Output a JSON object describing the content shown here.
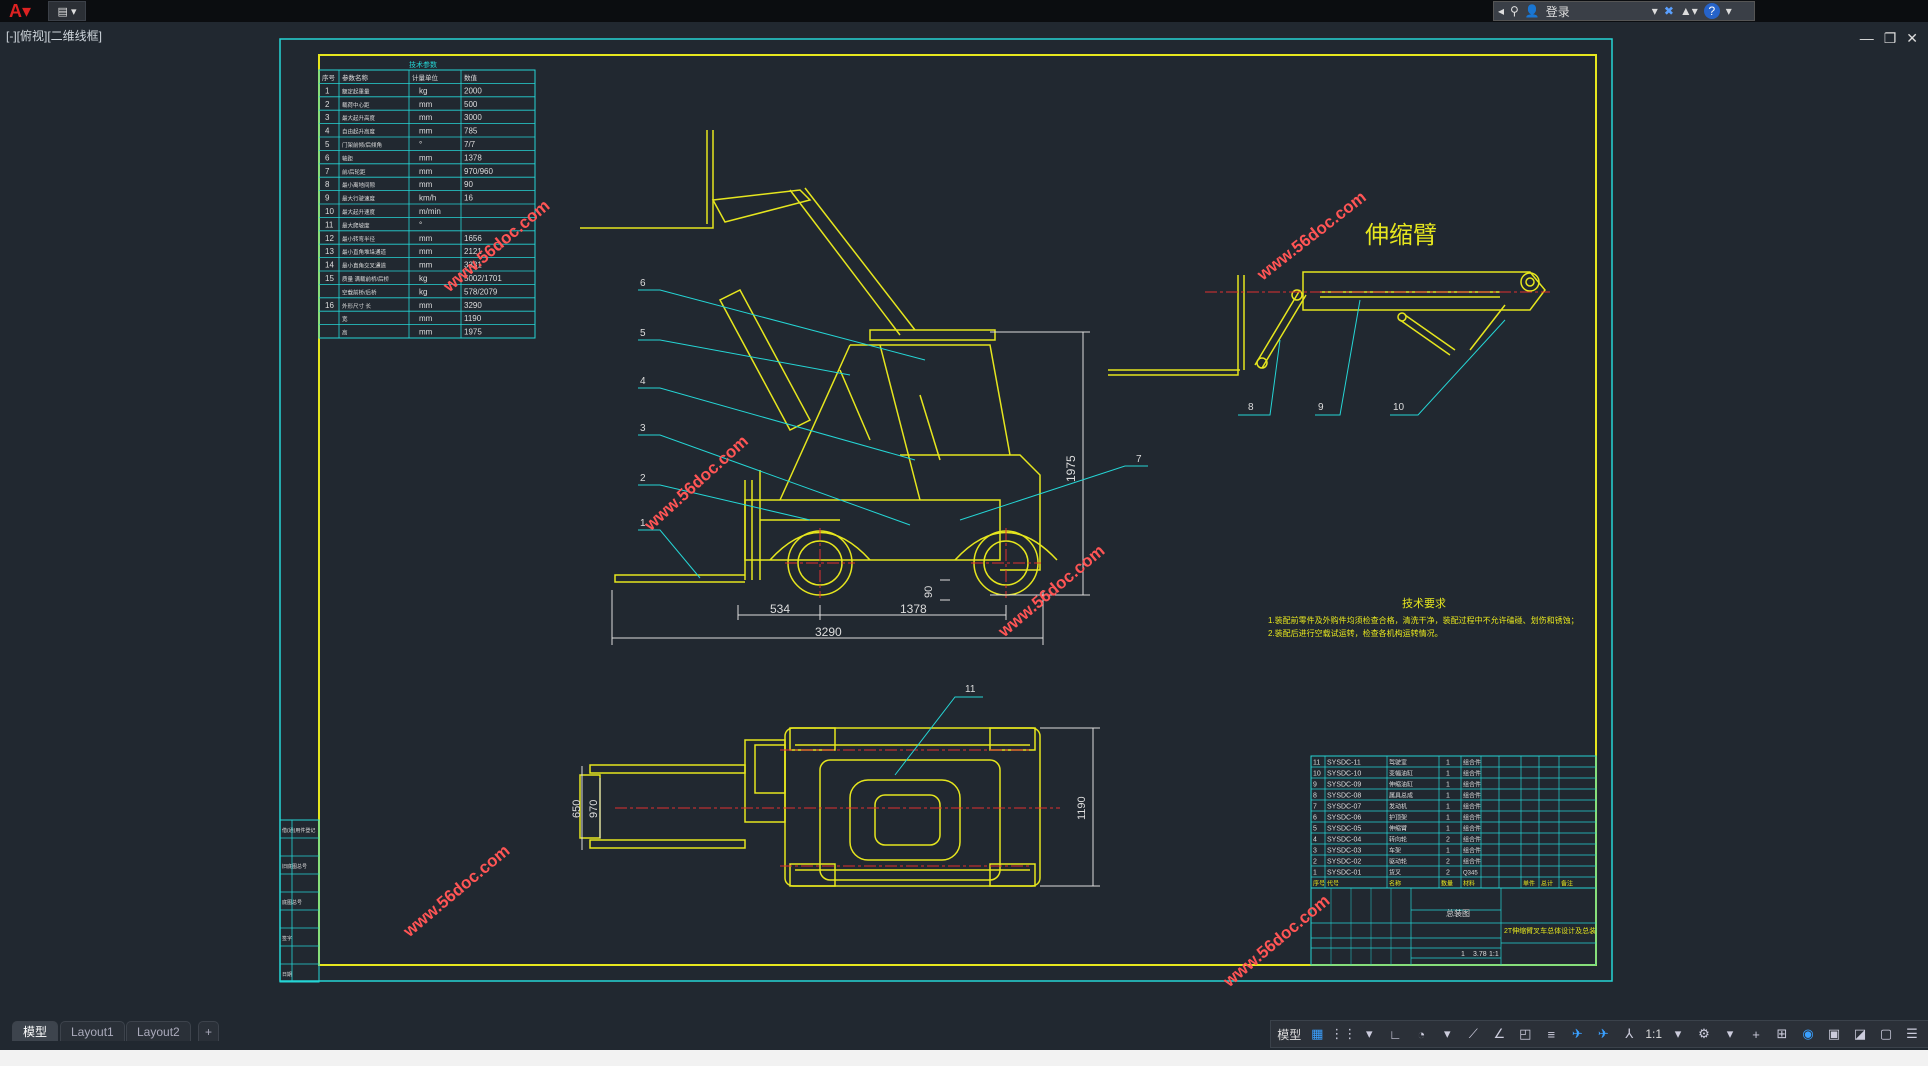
{
  "app": {
    "logo_letter": "A",
    "login_label": "登录",
    "view_label": "[-][俯视][二维线框]",
    "window_controls": [
      "—",
      "❐",
      "✕"
    ],
    "accent_color": "#1e88e5"
  },
  "drawing": {
    "param_table": {
      "title": "技术参数",
      "headers": [
        "序号",
        "参数名称",
        "计量单位",
        "数值"
      ],
      "rows": [
        {
          "no": "1",
          "name": "额定起重量",
          "unit": "kg",
          "value": "2000"
        },
        {
          "no": "2",
          "name": "载荷中心距",
          "unit": "mm",
          "value": "500"
        },
        {
          "no": "3",
          "name": "最大起升高度",
          "unit": "mm",
          "value": "3000"
        },
        {
          "no": "4",
          "name": "自由起升高度",
          "unit": "mm",
          "value": "785"
        },
        {
          "no": "5",
          "name": "门架前倾/后倾角",
          "unit": "°",
          "value": "7/7"
        },
        {
          "no": "6",
          "name": "轴距",
          "unit": "mm",
          "value": "1378"
        },
        {
          "no": "7",
          "name": "前/后轮距",
          "unit": "mm",
          "value": "970/960"
        },
        {
          "no": "8",
          "name": "最小离地间隙",
          "unit": "mm",
          "value": "90"
        },
        {
          "no": "9",
          "name": "最大行驶速度",
          "unit": "km/h",
          "value": "16"
        },
        {
          "no": "10",
          "name": "最大起升速度",
          "unit": "m/min",
          "value": ""
        },
        {
          "no": "11",
          "name": "最大爬坡度",
          "unit": "°",
          "value": ""
        },
        {
          "no": "12",
          "name": "最小转弯半径",
          "unit": "mm",
          "value": "1656"
        },
        {
          "no": "13",
          "name": "最小直角堆垛通道",
          "unit": "mm",
          "value": "2121"
        },
        {
          "no": "14",
          "name": "最小直角交叉通道",
          "unit": "mm",
          "value": "3331"
        },
        {
          "no": "15",
          "name": "质量 满载前桥/后桥",
          "unit": "kg",
          "value": "5002/1701"
        },
        {
          "no": "",
          "name": "空载前桥/后桥",
          "unit": "kg",
          "value": "578/2079"
        },
        {
          "no": "16",
          "name": "外形尺寸 长",
          "unit": "mm",
          "value": "3290"
        },
        {
          "no": "",
          "name": "宽",
          "unit": "mm",
          "value": "1190"
        },
        {
          "no": "",
          "name": "高",
          "unit": "mm",
          "value": "1975"
        }
      ]
    },
    "side_view": {
      "callouts": [
        "1",
        "2",
        "3",
        "4",
        "5",
        "6",
        "7"
      ],
      "dimensions": {
        "d534": "534",
        "d1378": "1378",
        "d3290": "3290",
        "d1975": "1975",
        "d90": "90"
      }
    },
    "telescopic_view": {
      "title": "伸缩臂",
      "callouts": [
        "8",
        "9",
        "10"
      ]
    },
    "top_view": {
      "callouts": [
        "11"
      ],
      "dimensions": {
        "d650": "650",
        "d970": "970",
        "d1190": "1190"
      }
    },
    "tech_requirements": {
      "title": "技术要求",
      "lines": [
        "1.装配前零件及外购件均须检查合格，清洗干净，装配过程中不允许磕碰、划伤和锈蚀；",
        "2.装配后进行空载试运转，检查各机构运转情况。"
      ]
    },
    "parts_list": {
      "rows": [
        {
          "no": "11",
          "code": "SYSDC-11",
          "name": "驾驶室",
          "qty": "1",
          "mat": "组合件"
        },
        {
          "no": "10",
          "code": "SYSDC-10",
          "name": "变幅油缸",
          "qty": "1",
          "mat": "组合件"
        },
        {
          "no": "9",
          "code": "SYSDC-09",
          "name": "伸缩油缸",
          "qty": "1",
          "mat": "组合件"
        },
        {
          "no": "8",
          "code": "SYSDC-08",
          "name": "属具总成",
          "qty": "1",
          "mat": "组合件"
        },
        {
          "no": "7",
          "code": "SYSDC-07",
          "name": "发动机",
          "qty": "1",
          "mat": "组合件"
        },
        {
          "no": "6",
          "code": "SYSDC-06",
          "name": "护顶架",
          "qty": "1",
          "mat": "组合件"
        },
        {
          "no": "5",
          "code": "SYSDC-05",
          "name": "伸缩臂",
          "qty": "1",
          "mat": "组合件"
        },
        {
          "no": "4",
          "code": "SYSDC-04",
          "name": "转向轮",
          "qty": "2",
          "mat": "组合件"
        },
        {
          "no": "3",
          "code": "SYSDC-03",
          "name": "车架",
          "qty": "1",
          "mat": "组合件"
        },
        {
          "no": "2",
          "code": "SYSDC-02",
          "name": "驱动轮",
          "qty": "2",
          "mat": "组合件"
        },
        {
          "no": "1",
          "code": "SYSDC-01",
          "name": "货叉",
          "qty": "2",
          "mat": "Q345"
        }
      ],
      "header": [
        "序号",
        "代号",
        "名称",
        "数量",
        "材料",
        "单件",
        "总计",
        "备注"
      ]
    },
    "title_block": {
      "assembly": "总装图",
      "drawing_title": "2T伸缩臂叉车总体设计及总装",
      "scale": "1:1",
      "weight": "3.78",
      "sheet": "1"
    },
    "left_strip_labels": [
      "借(通)用件登记",
      "",
      "旧底图总号",
      "",
      "底图总号",
      "",
      "签字",
      "",
      "日期"
    ],
    "watermark": "www.56doc.com"
  },
  "layout_tabs": [
    "模型",
    "Layout1",
    "Layout2",
    "+"
  ],
  "status": {
    "model_label": "模型",
    "scale_label": "1:1"
  }
}
